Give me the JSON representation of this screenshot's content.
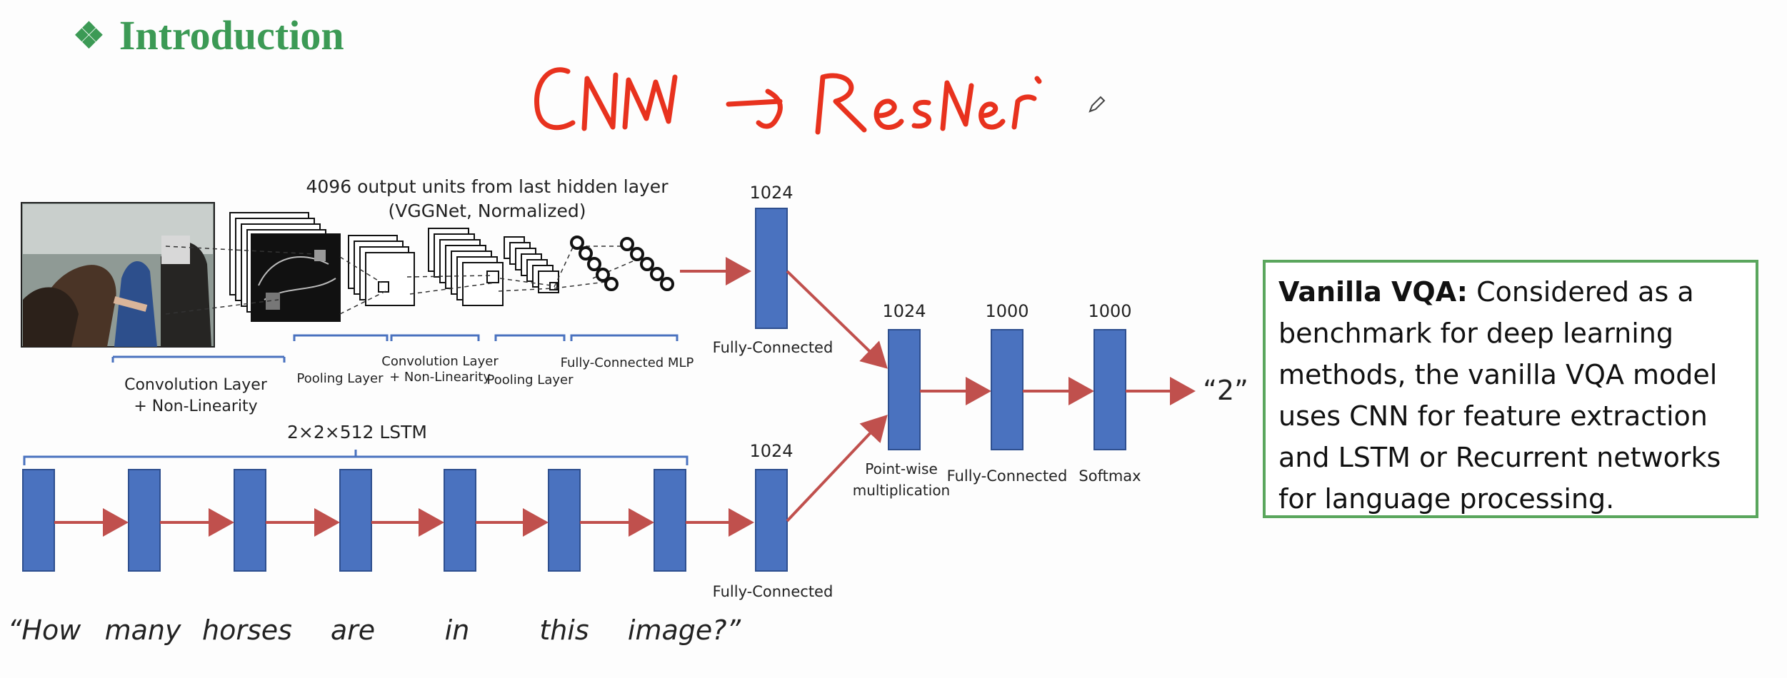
{
  "title": {
    "bullet": "❖",
    "text": "Introduction"
  },
  "annotation": {
    "handwritten": "CNN → ResNet"
  },
  "diagram": {
    "top_label_line1": "4096 output  units from last hidden layer",
    "top_label_line2": "(VGGNet, Normalized)",
    "conv_label_line1": "Convolution Layer",
    "conv_label_line2": "+ Non-Linearity",
    "pool1_label": "Pooling Layer",
    "conv2_label_line1": "Convolution Layer",
    "conv2_label_line2": "+ Non-Linearity",
    "pool2_label": "Pooling  Layer",
    "fc_mlp_label": "Fully-Connected MLP",
    "dim_top": "1024",
    "fc_top_label": "Fully-Connected",
    "lstm_label": "2×2×512 LSTM",
    "dim_bottom": "1024",
    "fc_bottom_label": "Fully-Connected",
    "dim_merge": "1024",
    "dim_fc": "1000",
    "dim_softmax": "1000",
    "pointwise_line1": "Point-wise",
    "pointwise_line2": "multiplication",
    "fc_final_label": "Fully-Connected",
    "softmax_label": "Softmax",
    "output": "“2”",
    "question_words": [
      "“How",
      "many",
      "horses",
      "are",
      "in",
      "this",
      "image?”"
    ]
  },
  "callout": {
    "bold": "Vanilla VQA:",
    "line1": " Considered as a",
    "line2": "benchmark for deep learning",
    "line3": "methods, the vanilla VQA model",
    "line4": "uses CNN for feature extraction",
    "line5": "and LSTM or Recurrent networks",
    "line6": "for language processing."
  },
  "colors": {
    "accent_green": "#3c9a55",
    "block_blue": "#4a72bf",
    "arrow_red": "#c0504d",
    "bracket_blue": "#4a72bf",
    "ink_red": "#e8321e"
  }
}
